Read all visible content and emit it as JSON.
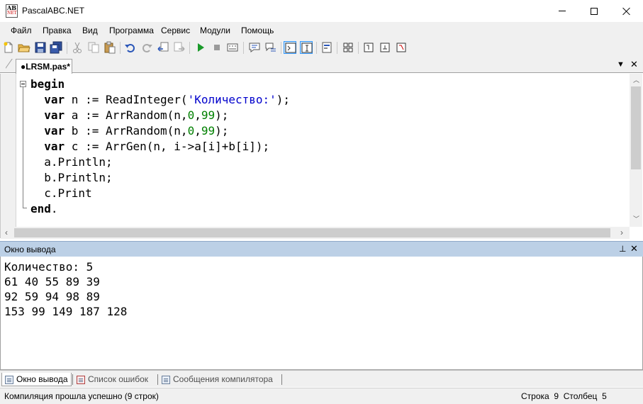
{
  "window": {
    "title": "PascalABC.NET",
    "icon_text": {
      "line1": "AB",
      "line2": "NET"
    }
  },
  "menu": [
    "Файл",
    "Правка",
    "Вид",
    "Программа",
    "Сервис",
    "Модули",
    "Помощь"
  ],
  "tabs": {
    "active_label": "●LRSM.pas*"
  },
  "editor": {
    "lines": [
      [
        {
          "t": "begin",
          "c": "kw"
        }
      ],
      [
        {
          "t": "  "
        },
        {
          "t": "var",
          "c": "kw"
        },
        {
          "t": " n := ReadInteger("
        },
        {
          "t": "'Количество:'",
          "c": "str"
        },
        {
          "t": ");"
        }
      ],
      [
        {
          "t": "  "
        },
        {
          "t": "var",
          "c": "kw"
        },
        {
          "t": " a := ArrRandom(n,"
        },
        {
          "t": "0",
          "c": "num"
        },
        {
          "t": ","
        },
        {
          "t": "99",
          "c": "num"
        },
        {
          "t": ");"
        }
      ],
      [
        {
          "t": "  "
        },
        {
          "t": "var",
          "c": "kw"
        },
        {
          "t": " b := ArrRandom(n,"
        },
        {
          "t": "0",
          "c": "num"
        },
        {
          "t": ","
        },
        {
          "t": "99",
          "c": "num"
        },
        {
          "t": ");"
        }
      ],
      [
        {
          "t": "  "
        },
        {
          "t": "var",
          "c": "kw"
        },
        {
          "t": " c := ArrGen(n, i->a[i]+b[i]);"
        }
      ],
      [
        {
          "t": "  a.Println;"
        }
      ],
      [
        {
          "t": "  b.Println;"
        }
      ],
      [
        {
          "t": "  c.Print"
        }
      ],
      [
        {
          "t": "end",
          "c": "kw"
        },
        {
          "t": "."
        }
      ]
    ]
  },
  "output": {
    "title": "Окно вывода",
    "lines": [
      "Количество: 5",
      "61 40 55 89 39",
      "92 59 94 98 89",
      "153 99 149 187 128"
    ]
  },
  "bottom_tabs": [
    {
      "label": "Окно вывода",
      "active": true
    },
    {
      "label": "Список ошибок",
      "active": false
    },
    {
      "label": "Сообщения компилятора",
      "active": false
    }
  ],
  "status": {
    "message": "Компиляция прошла успешно (9 строк)",
    "position": "Строка  9  Столбец  5"
  }
}
